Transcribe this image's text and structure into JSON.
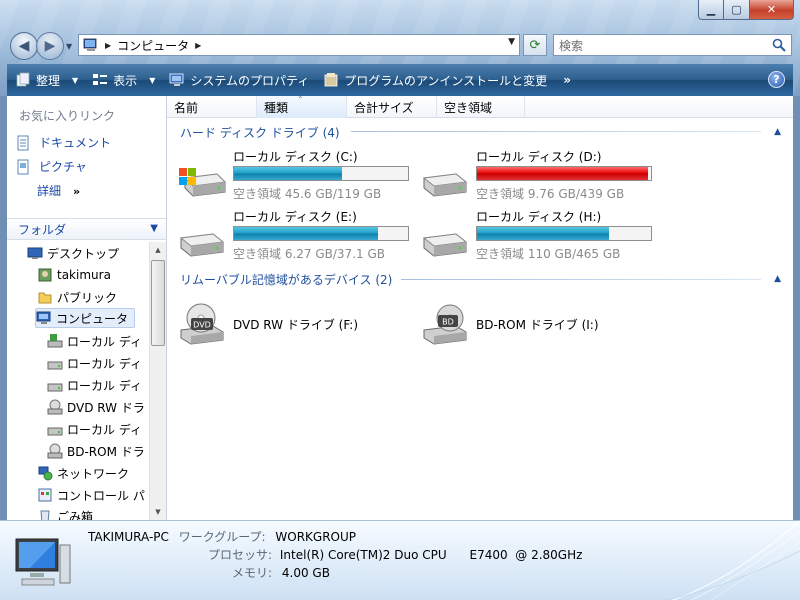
{
  "address": {
    "location": "コンピュータ"
  },
  "search": {
    "placeholder": "検索"
  },
  "toolbar": {
    "organize": "整理",
    "views": "表示",
    "system_properties": "システムのプロパティ",
    "uninstall": "プログラムのアンインストールと変更",
    "more": "»",
    "help": "?"
  },
  "favorites": {
    "title": "お気に入りリンク",
    "items": [
      {
        "label": "ドキュメント",
        "icon": "documents-icon"
      },
      {
        "label": "ピクチャ",
        "icon": "pictures-icon"
      }
    ],
    "more": "詳細",
    "more_arrows": "»"
  },
  "folders": {
    "title": "フォルダ",
    "tree": [
      {
        "label": "デスクトップ",
        "icon": "desktop-icon",
        "level": 1
      },
      {
        "label": "takimura",
        "icon": "user-folder-icon",
        "level": 2
      },
      {
        "label": "パブリック",
        "icon": "folder-icon",
        "level": 2
      },
      {
        "label": "コンピュータ",
        "icon": "computer-icon",
        "level": 2,
        "selected": true
      },
      {
        "label": "ローカル ディ",
        "icon": "system-drive-icon",
        "level": 3
      },
      {
        "label": "ローカル ディ",
        "icon": "drive-icon",
        "level": 3
      },
      {
        "label": "ローカル ディ",
        "icon": "drive-icon",
        "level": 3
      },
      {
        "label": "DVD RW ドラ",
        "icon": "optical-drive-icon",
        "level": 3
      },
      {
        "label": "ローカル ディ",
        "icon": "drive-icon",
        "level": 3
      },
      {
        "label": "BD-ROM ドラ",
        "icon": "optical-drive-icon",
        "level": 3
      },
      {
        "label": "ネットワーク",
        "icon": "network-icon",
        "level": 2
      },
      {
        "label": "コントロール パ",
        "icon": "control-panel-icon",
        "level": 2
      },
      {
        "label": "ごみ箱",
        "icon": "recycle-bin-icon",
        "level": 2
      }
    ]
  },
  "columns": [
    "名前",
    "種類",
    "合計サイズ",
    "空き領域"
  ],
  "groups": {
    "hdd": {
      "title": "ハード ディスク ドライブ (4)",
      "drives": [
        {
          "name": "ローカル ディスク (C:)",
          "free": "空き領域 45.6 GB/119 GB",
          "used_fraction": 0.62,
          "warning": false,
          "icon": "system-drive-icon"
        },
        {
          "name": "ローカル ディスク (D:)",
          "free": "空き領域 9.76 GB/439 GB",
          "used_fraction": 0.98,
          "warning": true,
          "icon": "drive-icon"
        },
        {
          "name": "ローカル ディスク (E:)",
          "free": "空き領域 6.27 GB/37.1 GB",
          "used_fraction": 0.83,
          "warning": false,
          "icon": "drive-icon"
        },
        {
          "name": "ローカル ディスク (H:)",
          "free": "空き領域 110 GB/465 GB",
          "used_fraction": 0.76,
          "warning": false,
          "icon": "drive-icon"
        }
      ]
    },
    "removable": {
      "title": "リムーバブル記憶域があるデバイス (2)",
      "drives": [
        {
          "name": "DVD RW ドライブ (F:)",
          "badge": "DVD",
          "icon": "dvd-drive-icon"
        },
        {
          "name": "BD-ROM ドライブ (I:)",
          "badge": "BD",
          "icon": "bd-drive-icon"
        }
      ]
    }
  },
  "details": {
    "computer_name": "TAKIMURA-PC",
    "workgroup_label": "ワークグループ:",
    "workgroup": "WORKGROUP",
    "processor_label": "プロセッサ:",
    "processor": "Intel(R) Core(TM)2 Duo CPU      E7400  @ 2.80GHz",
    "memory_label": "メモリ:",
    "memory": "4.00 GB"
  },
  "colors": {
    "toolbar": "#2d5f8f",
    "link": "#1a49a8",
    "bar_fill": "#1f9cc7",
    "bar_warning": "#e60000"
  }
}
